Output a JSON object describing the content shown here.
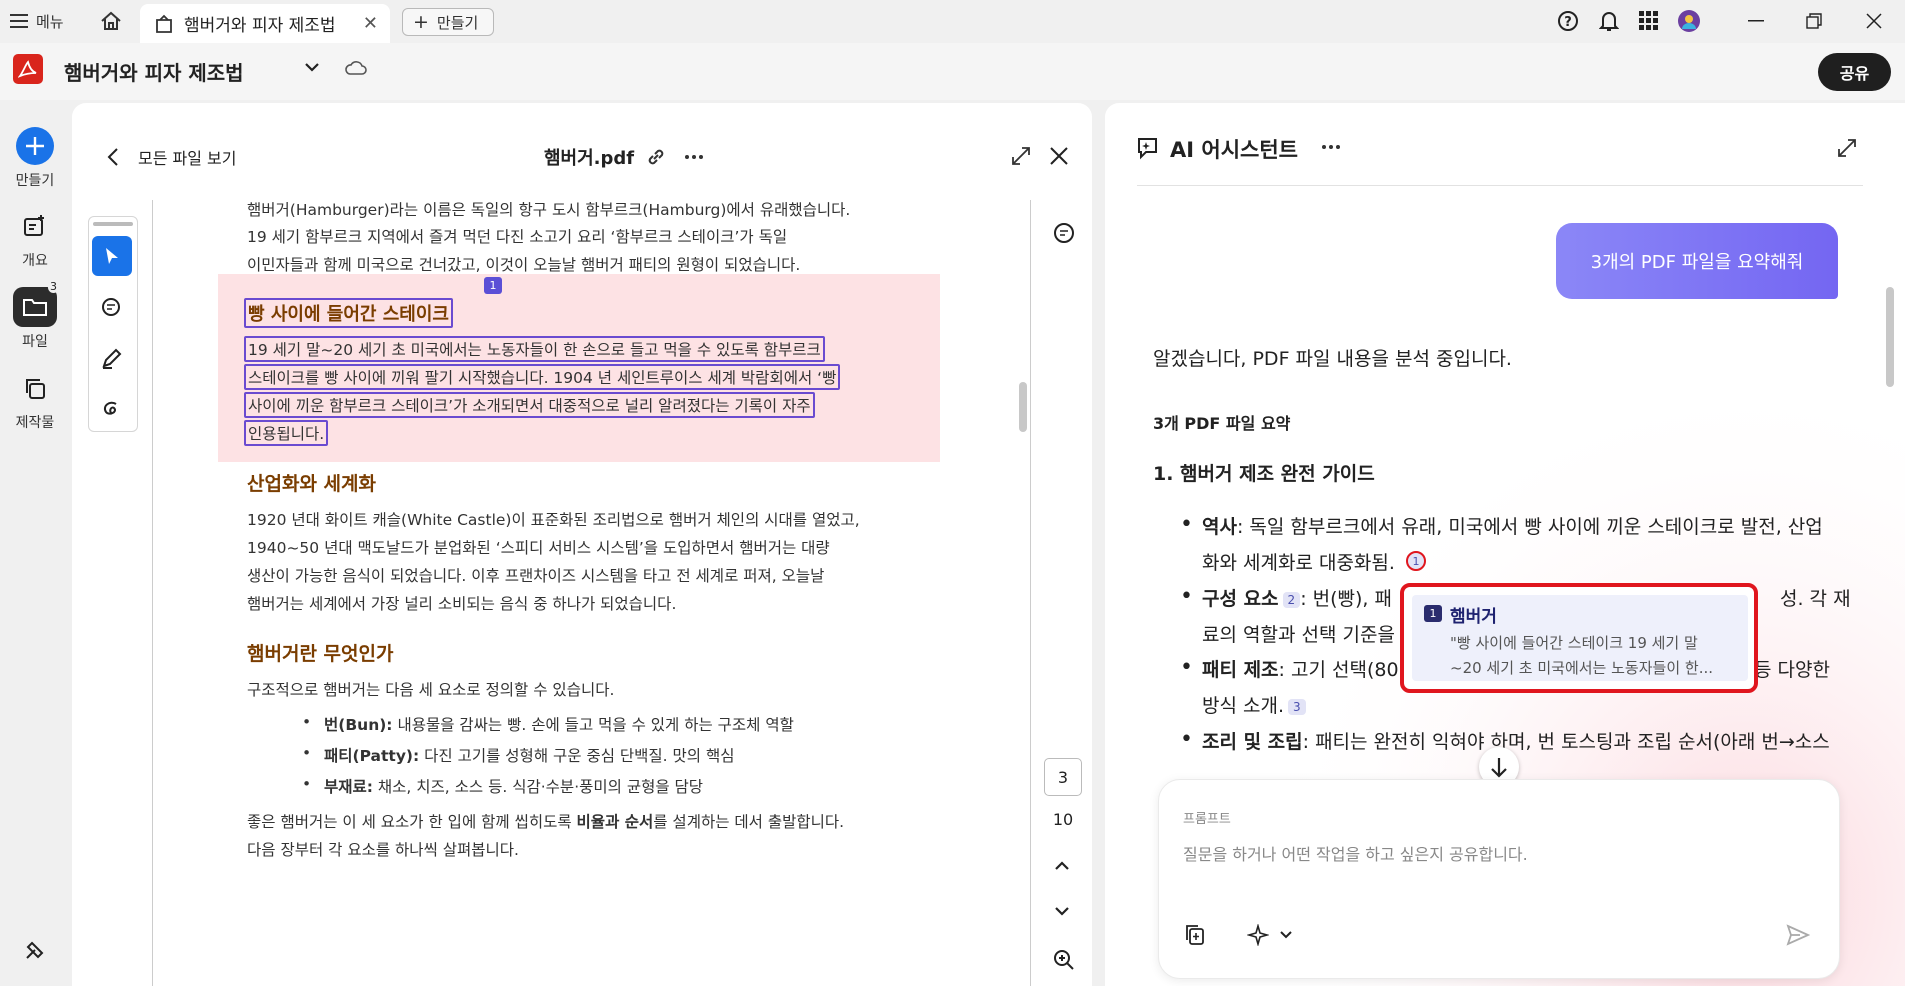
{
  "titlebar": {
    "menu_label": "메뉴",
    "tab_title": "햄버거와 피자 제조법",
    "new_tab_label": "만들기"
  },
  "header": {
    "doc_title": "햄버거와 피자 제조법",
    "share_label": "공유"
  },
  "rail": {
    "create_label": "만들기",
    "overview_label": "개요",
    "files_label": "파일",
    "files_badge": "3",
    "products_label": "제작물"
  },
  "doc": {
    "back_label": "모든 파일 보기",
    "file_name": "햄버거.pdf",
    "lines_top": [
      "햄버거(Hamburger)라는 이름은 독일의 항구 도시 함부르크(Hamburg)에서 유래했습니다.",
      "19 세기 함부르크 지역에서 즐겨 먹던 다진 소고기 요리 ‘함부르크 스테이크’가 독일",
      "이민자들과 함께 미국으로 건너갔고, 이것이 오늘날 햄버거 패티의 원형이 되었습니다."
    ],
    "citation_badge": "1",
    "h_steak": "빵 사이에 들어간 스테이크",
    "steak_lines": [
      "19 세기 말~20 세기 초 미국에서는 노동자들이 한 손으로 들고 먹을 수 있도록 함부르크",
      "스테이크를 빵 사이에 끼워 팔기 시작했습니다. 1904 년 세인트루이스 세계 박람회에서 ‘빵",
      "사이에 끼운 함부르크 스테이크’가 소개되면서 대중적으로 널리 알려졌다는 기록이 자주",
      "인용됩니다."
    ],
    "h_industry": "산업화와 세계화",
    "industry_lines": [
      "1920 년대 화이트 캐슬(White Castle)이 표준화된 조리법으로 햄버거 체인의 시대를 열었고,",
      "1940~50 년대 맥도날드가 분업화된 ‘스피디 서비스 시스템’을 도입하면서 햄버거는 대량",
      "생산이 가능한 음식이 되었습니다. 이후 프랜차이즈 시스템을 타고 전 세계로 퍼져, 오늘날",
      "햄버거는 세계에서 가장 널리 소비되는 음식 중 하나가 되었습니다."
    ],
    "h_what": "햄버거란 무엇인가",
    "what_intro": "구조적으로 햄버거는 다음 세 요소로 정의할 수 있습니다.",
    "bullets": [
      {
        "term": "번(Bun):",
        "desc": " 내용물을 감싸는 빵. 손에 들고 먹을 수 있게 하는 구조체 역할"
      },
      {
        "term": "패티(Patty):",
        "desc": " 다진 고기를 성형해 구운 중심 단백질. 맛의 핵심"
      },
      {
        "term": "부재료:",
        "desc": " 채소, 치즈, 소스 등. 식감·수분·풍미의 균형을 담당"
      }
    ],
    "closing_1a": "좋은 햄버거는 이 세 요소가 한 입에 함께 씹히도록 ",
    "closing_1b": "비율과 순서",
    "closing_1c": "를 설계하는 데서 출발합니다.",
    "closing_2": "다음 장부터 각 요소를 하나씩 살펴봅니다.",
    "page_current": "3",
    "page_total": "10"
  },
  "assistant": {
    "title": "AI 어시스턴트",
    "user_message": "3개의 PDF 파일을 요약해줘",
    "reply_intro": "알겠습니다, PDF 파일 내용을 분석 중입니다.",
    "summary_heading": "3개 PDF 파일 요약",
    "section1_heading": "1. 햄버거 제조 완전 가이드",
    "items": [
      {
        "term": "역사",
        "line1": ": 독일 함부르크에서 유래, 미국에서 빵 사이에 끼운 스테이크로 발전, 산업",
        "line2": "화와 세계화로 대중화됨.",
        "cite": "1"
      },
      {
        "term": "구성 요소",
        "cite": "2",
        "line1": ": 번(빵), 패",
        "line1_tail": "성. 각 재",
        "line2": "료의 역할과 선택 기준을"
      },
      {
        "term": "패티 제조",
        "line1": ": 고기 선택(80",
        "line1_tail": "등 다양한",
        "line2": "방식 소개.",
        "cite": "3"
      },
      {
        "term": "조리 및 조립",
        "line1": ": 패티는 완전히 익혀야 하며, 번 토스팅과 조립 순서(아래 번→소스"
      }
    ],
    "tooltip": {
      "num": "1",
      "title": "햄버거",
      "line1": "\"빵 사이에 들어간 스테이크 19 세기 말",
      "line2": "~20 세기 초 미국에서는 노동자들이 한..."
    },
    "prompt_label": "프롬프트",
    "prompt_placeholder": "질문을 하거나 어떤 작업을 하고 싶은지 공유합니다."
  },
  "colors": {
    "accent_purple": "#7b6ef6",
    "highlight_pink": "#fde2e4",
    "tooltip_red": "#e0161e",
    "acrobat_red": "#d9251c",
    "rail_blue": "#1a73e8"
  }
}
